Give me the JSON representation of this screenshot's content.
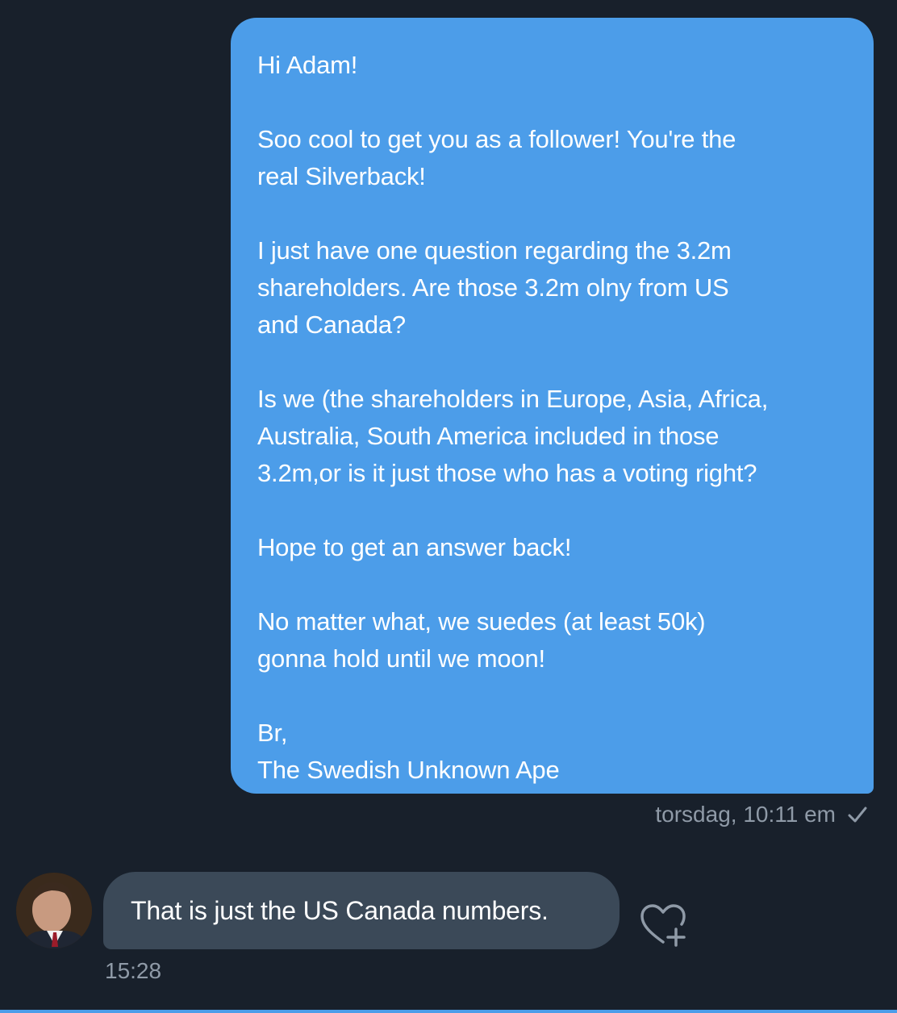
{
  "conversation": {
    "sent_message": {
      "paragraphs": [
        "Hi Adam!",
        "Soo cool to get you as a follower! You're the\nreal Silverback!",
        "I just have one question regarding the 3.2m\nshareholders. Are those 3.2m olny from US\nand Canada?",
        "Is we (the shareholders in Europe, Asia, Africa,\nAustralia, South America included in those\n3.2m,or is it just those who has a voting right?",
        "Hope to get an answer back!",
        "No matter what, we suedes (at least 50k)\ngonna hold until we moon!",
        "Br,\nThe Swedish Unknown Ape"
      ],
      "timestamp": "torsdag, 10:11 em",
      "status_icon": "check-icon"
    },
    "received_message": {
      "text": "That is just the US Canada numbers.",
      "timestamp": "15:28",
      "avatar_icon": "avatar",
      "reaction_icon": "heart-add-icon"
    }
  },
  "colors": {
    "background": "#18202b",
    "sent_bubble": "#4c9de9",
    "received_bubble": "#3b4958",
    "meta_text": "#8f9aa7"
  }
}
